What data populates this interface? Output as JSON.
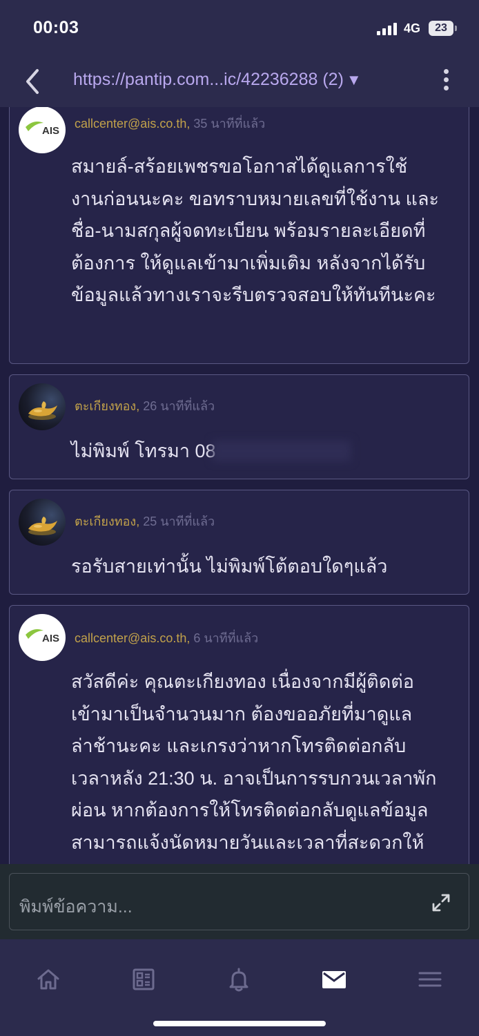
{
  "status_bar": {
    "time": "00:03",
    "network": "4G",
    "battery": "23"
  },
  "header": {
    "url": "https://pantip.com...ic/42236288 (2)",
    "dropdown_glyph": "▼"
  },
  "messages": [
    {
      "author": "callcenter@ais.co.th,",
      "time_ago": "35 นาทีที่แล้ว",
      "avatar": "ais-logo",
      "avatar_text": "AIS",
      "lines": [
        "สมายล์-สร้อยเพชรขอโอกาสได้ดูแลการใช้",
        "งานก่อนนะคะ ขอทราบหมายเลขที่ใช้งาน และ",
        "ชื่อ-นามสกุลผู้จดทะเบียน พร้อมรายละเอียดที่",
        "ต้องการ ให้ดูแลเข้ามาเพิ่มเติม หลังจากได้รับ",
        "ข้อมูลแล้วทางเราจะรีบตรวจสอบให้ทันทีนะคะ"
      ]
    },
    {
      "author": "ตะเกียงทอง,",
      "time_ago": "26 นาทีที่แล้ว",
      "avatar": "magic-lamp",
      "lines": [
        "ไม่พิมพ์ โทรมา 08"
      ]
    },
    {
      "author": "ตะเกียงทอง,",
      "time_ago": "25 นาทีที่แล้ว",
      "avatar": "magic-lamp",
      "lines": [
        "รอรับสายเท่านั้น ไม่พิมพ์โต้ตอบใดๆแล้ว"
      ]
    },
    {
      "author": "callcenter@ais.co.th,",
      "time_ago": "6 นาทีที่แล้ว",
      "avatar": "ais-logo",
      "avatar_text": "AIS",
      "lines": [
        "สวัสดีค่ะ คุณตะเกียงทอง เนื่องจากมีผู้ติดต่อ",
        "เข้ามาเป็นจำนวนมาก ต้องขออภัยที่มาดูแล",
        "ล่าช้านะคะ และเกรงว่าหากโทรติดต่อกลับ",
        "เวลาหลัง 21:30 น. อาจเป็นการรบกวนเวลาพัก",
        "ผ่อน หากต้องการให้โทรติดต่อกลับดูแลข้อมูล",
        "สามารถแจ้งนัดหมายวันและเวลาที่สะดวกให้"
      ]
    }
  ],
  "composer": {
    "placeholder": "พิมพ์ข้อความ..."
  },
  "bottom_nav": [
    {
      "icon": "home-icon",
      "active": false
    },
    {
      "icon": "feed-icon",
      "active": false
    },
    {
      "icon": "bell-icon",
      "active": false
    },
    {
      "icon": "mail-icon",
      "active": true
    },
    {
      "icon": "menu-icon",
      "active": false
    }
  ],
  "colors": {
    "background": "#1f1d3f",
    "card": "#262449",
    "card_border": "#5a5883",
    "bar": "#2c2b4d",
    "url": "#b9a8ee",
    "author": "#c2a24a",
    "timestamp": "#6f6d92",
    "ais_green": "#8cc63f"
  }
}
